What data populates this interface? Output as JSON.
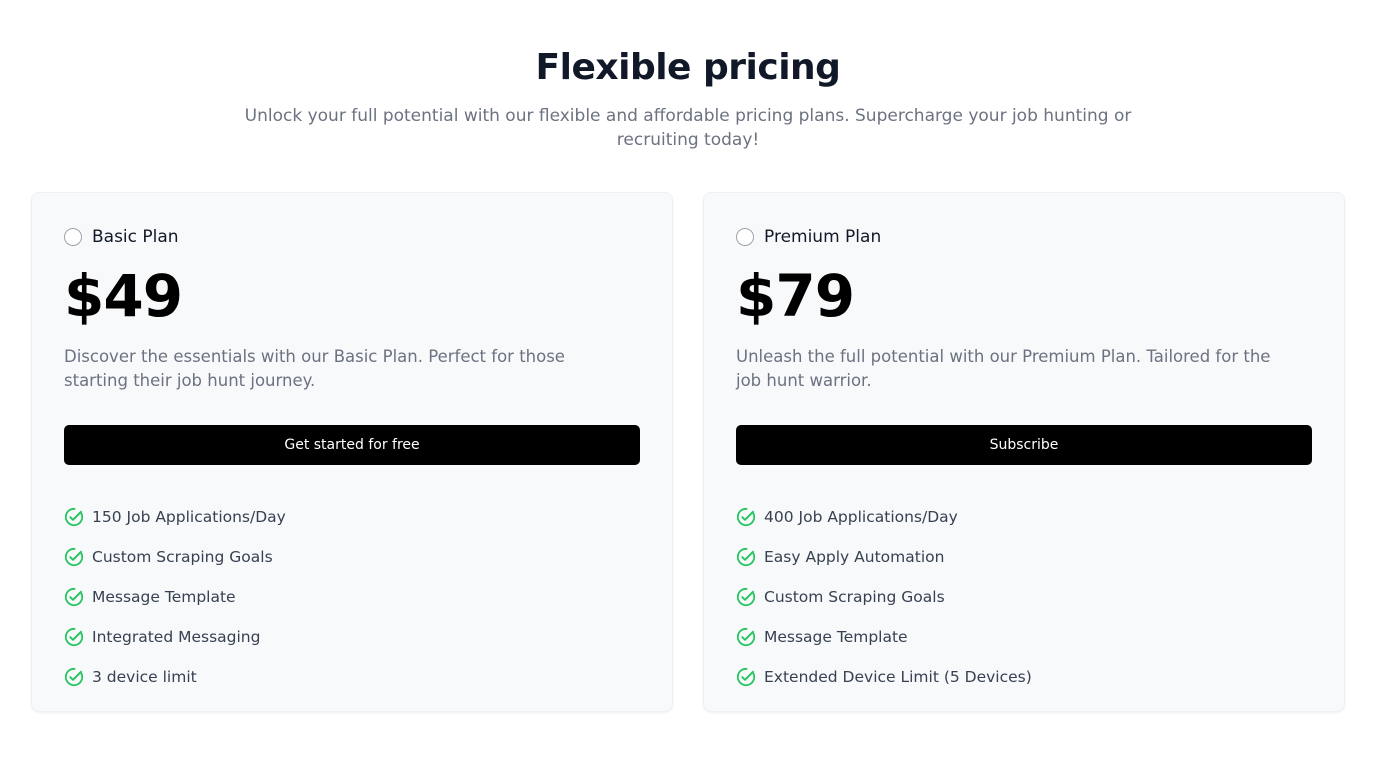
{
  "header": {
    "title": "Flexible pricing",
    "subtitle": "Unlock your full potential with our flexible and affordable pricing plans. Supercharge your job hunting or recruiting today!"
  },
  "colors": {
    "check": "#22c55e",
    "button_bg": "#000000",
    "card_bg": "#f8f9fb"
  },
  "plans": [
    {
      "name": "Basic Plan",
      "price": "$49",
      "description": "Discover the essentials with our Basic Plan. Perfect for those starting their job hunt journey.",
      "cta": "Get started for free",
      "selected": false,
      "features": [
        "150 Job Applications/Day",
        "Custom Scraping Goals",
        "Message Template",
        "Integrated Messaging",
        "3 device limit"
      ]
    },
    {
      "name": "Premium Plan",
      "price": "$79",
      "description": "Unleash the full potential with our Premium Plan. Tailored for the job hunt warrior.",
      "cta": "Subscribe",
      "selected": false,
      "features": [
        "400 Job Applications/Day",
        "Easy Apply Automation",
        "Custom Scraping Goals",
        "Message Template",
        "Extended Device Limit (5 Devices)"
      ]
    }
  ],
  "icons": {
    "feature": "check-circle-icon",
    "plan_select": "radio-icon"
  }
}
